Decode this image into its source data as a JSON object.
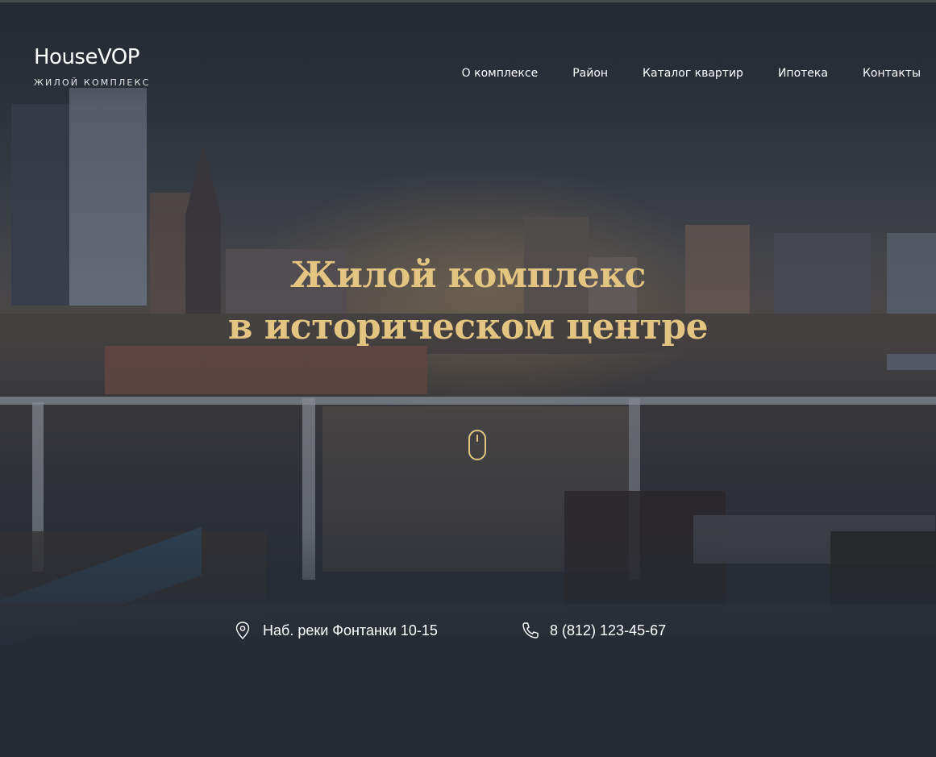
{
  "header": {
    "logo_name": "HouseVOP",
    "logo_sub": "ЖИЛОЙ КОМПЛЕКС",
    "nav": [
      {
        "label": "О комплексе"
      },
      {
        "label": "Район"
      },
      {
        "label": "Каталог квартир"
      },
      {
        "label": "Ипотека"
      },
      {
        "label": "Контакты"
      }
    ]
  },
  "hero": {
    "title_line1": "Жилой комплекс",
    "title_line2": "в историческом центре",
    "scroll_icon": "mouse-scroll-icon"
  },
  "contacts": {
    "address_icon": "location-pin-icon",
    "address": "Наб. реки Фонтанки 10-15",
    "phone_icon": "phone-icon",
    "phone": "8 (812) 123-45-67"
  },
  "colors": {
    "background": "#262b35",
    "accent_gold": "#e3c581",
    "text": "#ffffff"
  }
}
